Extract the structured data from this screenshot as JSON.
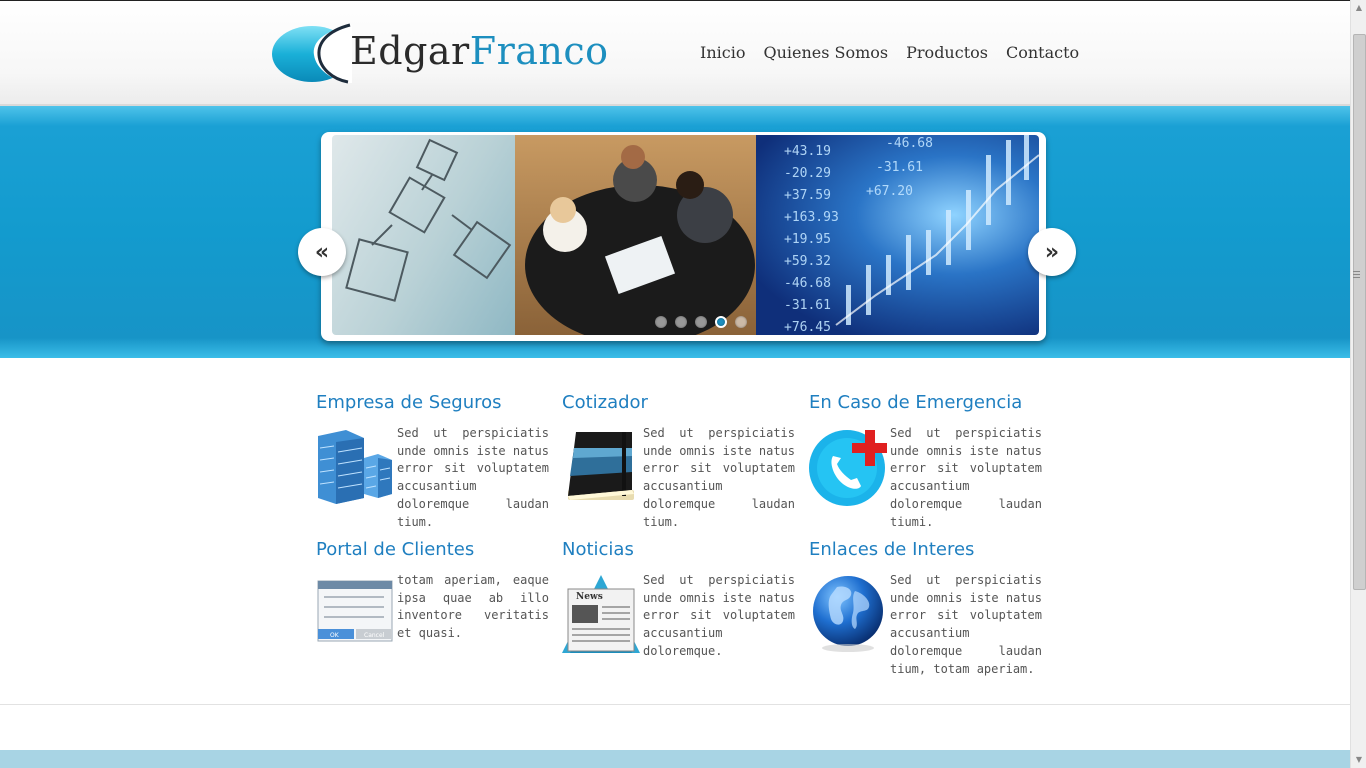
{
  "header": {
    "logo": {
      "part1": "Edgar",
      "part2": "Franco",
      "color_dark": "#2b2b2b",
      "color_accent": "#1d8fbf"
    },
    "nav": [
      {
        "label": "Inicio"
      },
      {
        "label": "Quienes Somos"
      },
      {
        "label": "Productos"
      },
      {
        "label": "Contacto"
      }
    ]
  },
  "slider": {
    "prev_symbol": "«",
    "next_symbol": "»",
    "dots": 5,
    "active_dot": 4
  },
  "features": [
    {
      "title": "Empresa de Seguros",
      "icon": "building-icon",
      "text": "Sed ut perspiciatis unde omnis iste natus error sit voluptatem accusantium doloremque laudan tium."
    },
    {
      "title": "Cotizador",
      "icon": "notebook-icon",
      "text": "Sed ut perspiciatis unde omnis iste natus error sit voluptatem accusantium doloremque laudan tium."
    },
    {
      "title": "En Caso de Emergencia",
      "icon": "emergency-phone-icon",
      "text": "Sed ut perspiciatis unde omnis iste natus error sit voluptatem accusantium doloremque laudan tiumi."
    },
    {
      "title": "Portal de Clientes",
      "icon": "login-form-icon",
      "text": "totam aperiam, eaque ipsa quae ab illo inventore veritatis et quasi."
    },
    {
      "title": "Noticias",
      "icon": "newspaper-icon",
      "text": "Sed ut perspiciatis unde omnis iste natus error sit voluptatem accusantium doloremque."
    },
    {
      "title": "Enlaces de Interes",
      "icon": "globe-icon",
      "text": "Sed ut perspiciatis unde omnis iste natus error sit voluptatem accusantium doloremque laudan tium, totam aperiam."
    }
  ],
  "news_icon_label": "News",
  "form_icon_buttons": {
    "ok": "OK",
    "cancel": "Cancel"
  },
  "colors": {
    "banner": "#139bce",
    "heading": "#1f7fc0",
    "footer": "#a8d4e4"
  }
}
